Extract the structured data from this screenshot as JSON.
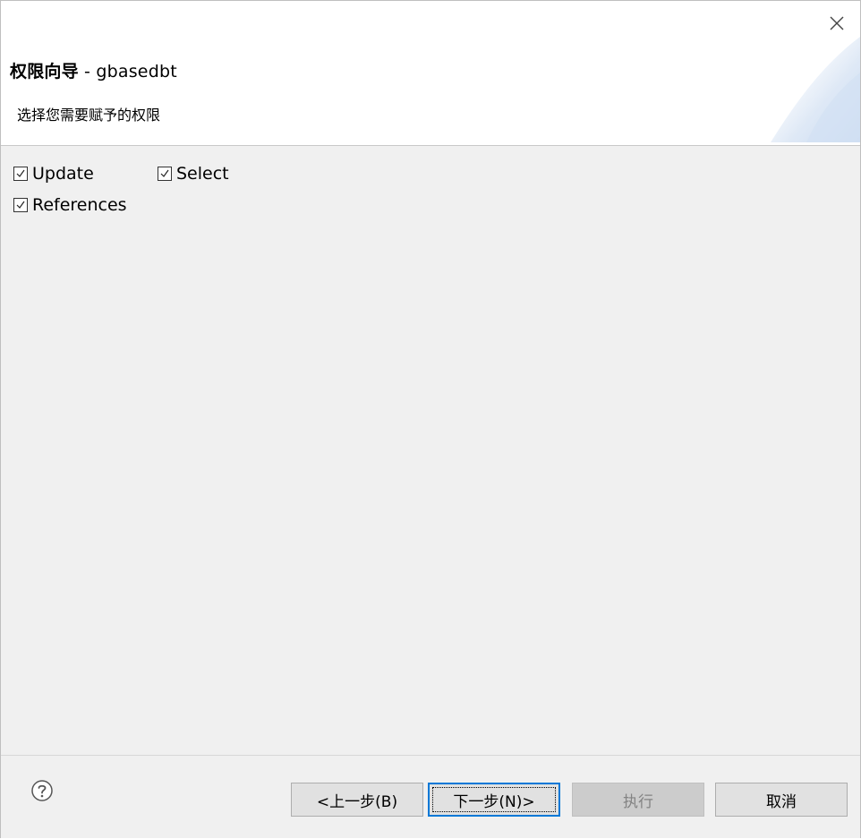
{
  "dialog": {
    "title_bold": "权限向导",
    "title_rest": " - gbasedbt",
    "subtitle": "选择您需要赋予的权限",
    "close_icon": "close-icon"
  },
  "permissions": [
    {
      "label": "Update",
      "checked": true
    },
    {
      "label": "Select",
      "checked": true
    },
    {
      "label": "References",
      "checked": true
    }
  ],
  "footer": {
    "help_icon": "help-icon",
    "back_label": "<上一步(B)",
    "next_label": "下一步(N)>",
    "execute_label": "执行",
    "cancel_label": "取消"
  },
  "colors": {
    "accent": "#0078d7",
    "content_bg": "#f0f0f0",
    "button_bg": "#e1e1e1",
    "disabled_bg": "#cccccc"
  }
}
